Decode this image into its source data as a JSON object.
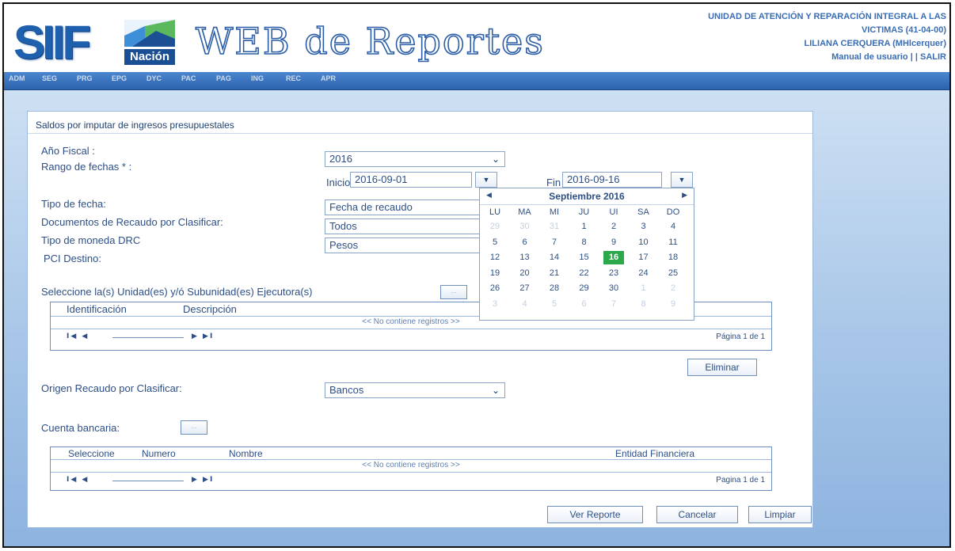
{
  "header": {
    "logo_text": "SIIF",
    "logo_subtext": "Nación",
    "app_title": "WEB de Reportes",
    "org_line1": "UNIDAD DE ATENCIÓN Y REPARACIÓN INTEGRAL A LAS",
    "org_line2": "VICTIMAS (41-04-00)",
    "user": "LILIANA CERQUERA (MHlcerquer)",
    "manual_link": "Manual de usuario",
    "separator": "| |",
    "exit_link": "SALIR"
  },
  "nav": [
    "ADM",
    "SEG",
    "PRG",
    "EPG",
    "DYC",
    "PAC",
    "PAG",
    "ING",
    "REC",
    "APR"
  ],
  "panel": {
    "title": "Saldos por imputar de ingresos presupuestales"
  },
  "form": {
    "anio_label": "Año Fiscal :",
    "anio_value": "2016",
    "rango_label": "Rango de fechas * :",
    "inicio_label": "Inicio",
    "inicio_value": "2016-09-01",
    "fin_label": "Fin",
    "fin_value": "2016-09-16",
    "tipo_fecha_label": "Tipo de fecha:",
    "tipo_fecha_value": "Fecha de recaudo",
    "docs_label": "Documentos de Recaudo por Clasificar:",
    "docs_value": "Todos",
    "moneda_label": "Tipo de moneda DRC",
    "moneda_value": "Pesos",
    "pci_label": "PCI Destino:",
    "unidades_label": "Seleccione la(s) Unidad(es) y/ó Subunidad(es) Ejecutora(s)",
    "origen_label": "Origen Recaudo por Clasificar:",
    "origen_value": "Bancos",
    "cuenta_label": "Cuenta bancaria:",
    "lookup_button": "..."
  },
  "grid1": {
    "columns": [
      "Identificación",
      "Descripción"
    ],
    "empty": "<< No contiene registros >>",
    "pager_first": "I◀ ◀",
    "pager_last": "▶ ▶I",
    "page_text": "Página 1 de 1"
  },
  "eliminar_button": "Eliminar",
  "grid2": {
    "columns": [
      "Seleccione",
      "Numero",
      "Nombre",
      "Entidad Financiera"
    ],
    "empty": "<< No contiene registros >>",
    "pager_first": "I◀ ◀",
    "pager_last": "▶ ▶I",
    "page_text": "Pagina 1 de 1"
  },
  "actions": {
    "ver_reporte": "Ver Reporte",
    "cancelar": "Cancelar",
    "limpiar": "Limpiar"
  },
  "calendar": {
    "title": "Septiembre 2016",
    "prev": "◀",
    "next": "▶",
    "weekdays": [
      "LU",
      "MA",
      "MI",
      "JU",
      "UI",
      "SA",
      "DO"
    ],
    "weeks": [
      [
        {
          "d": "29",
          "o": true
        },
        {
          "d": "30",
          "o": true
        },
        {
          "d": "31",
          "o": true
        },
        {
          "d": "1"
        },
        {
          "d": "2"
        },
        {
          "d": "3"
        },
        {
          "d": "4"
        }
      ],
      [
        {
          "d": "5"
        },
        {
          "d": "6"
        },
        {
          "d": "7"
        },
        {
          "d": "8"
        },
        {
          "d": "9"
        },
        {
          "d": "10"
        },
        {
          "d": "11"
        }
      ],
      [
        {
          "d": "12"
        },
        {
          "d": "13"
        },
        {
          "d": "14"
        },
        {
          "d": "15"
        },
        {
          "d": "16",
          "sel": true
        },
        {
          "d": "17"
        },
        {
          "d": "18"
        }
      ],
      [
        {
          "d": "19"
        },
        {
          "d": "20"
        },
        {
          "d": "21"
        },
        {
          "d": "22"
        },
        {
          "d": "23"
        },
        {
          "d": "24"
        },
        {
          "d": "25"
        }
      ],
      [
        {
          "d": "26"
        },
        {
          "d": "27"
        },
        {
          "d": "28"
        },
        {
          "d": "29"
        },
        {
          "d": "30"
        },
        {
          "d": "1",
          "o": true
        },
        {
          "d": "2",
          "o": true
        }
      ],
      [
        {
          "d": "3",
          "o": true
        },
        {
          "d": "4",
          "o": true
        },
        {
          "d": "5",
          "o": true
        },
        {
          "d": "6",
          "o": true
        },
        {
          "d": "7",
          "o": true
        },
        {
          "d": "8",
          "o": true
        },
        {
          "d": "9",
          "o": true
        }
      ]
    ]
  },
  "colors": {
    "accent": "#2d4f86",
    "brand": "#1e5fae",
    "selected_day": "#2aa84a"
  }
}
